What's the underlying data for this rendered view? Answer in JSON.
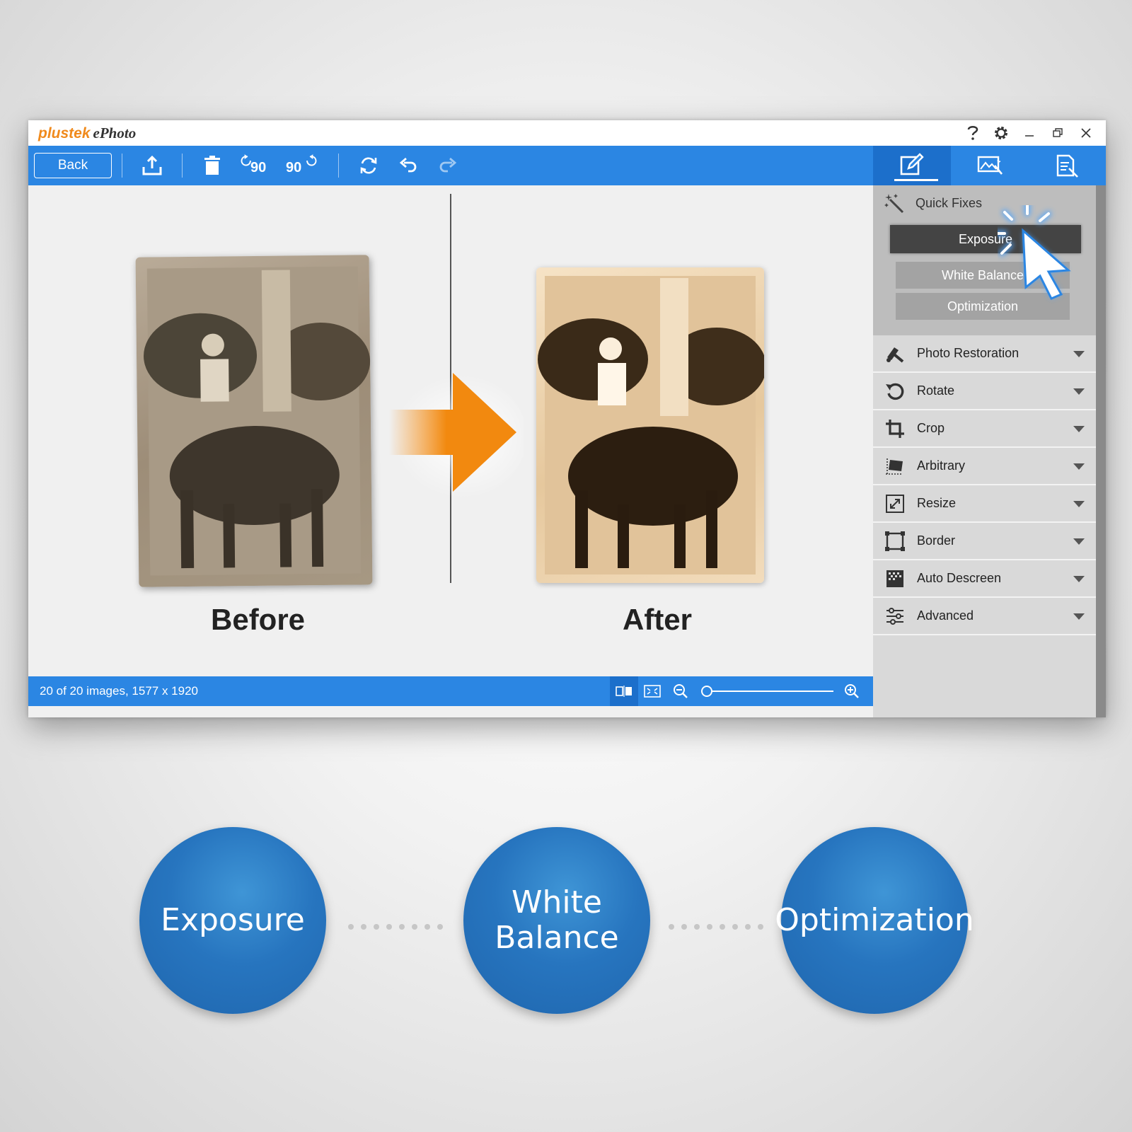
{
  "app": {
    "brand": "plustek",
    "product": "ePhoto"
  },
  "window_controls": [
    "help-icon",
    "gear-icon",
    "minimize-icon",
    "restore-icon",
    "close-icon"
  ],
  "toolbar": {
    "back_label": "Back",
    "rotate_ccw_label": "90",
    "rotate_cw_label": "90"
  },
  "canvas": {
    "before_label": "Before",
    "after_label": "After"
  },
  "statusbar": {
    "info": "20 of 20 images, 1577 x 1920",
    "zoom_level": 0.02
  },
  "sidebar": {
    "quick_fixes": {
      "title": "Quick Fixes",
      "buttons": [
        "Exposure",
        "White Balance",
        "Optimization"
      ]
    },
    "items": [
      {
        "label": "Photo Restoration",
        "icon": "photo-restoration-icon"
      },
      {
        "label": "Rotate",
        "icon": "rotate-icon"
      },
      {
        "label": "Crop",
        "icon": "crop-icon"
      },
      {
        "label": "Arbitrary",
        "icon": "arbitrary-icon"
      },
      {
        "label": "Resize",
        "icon": "resize-icon"
      },
      {
        "label": "Border",
        "icon": "border-icon"
      },
      {
        "label": "Auto Descreen",
        "icon": "descreen-icon"
      },
      {
        "label": "Advanced",
        "icon": "sliders-icon"
      }
    ]
  },
  "features": {
    "exposure": "Exposure",
    "white_balance_line1": "White",
    "white_balance_line2": "Balance",
    "optimization": "Optimization"
  },
  "colors": {
    "toolbar_blue": "#2b86e3",
    "arrow_orange": "#f2890f",
    "circle_blue": "#2775bf"
  }
}
